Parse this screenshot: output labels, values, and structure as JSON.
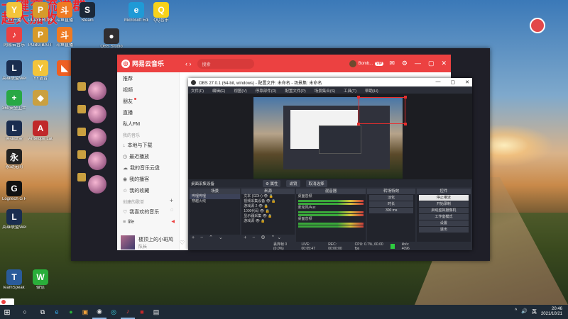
{
  "watermark": {
    "line1": "一键交流进群",
    "line2": "超大加收"
  },
  "desktop": {
    "icons": [
      {
        "label": "YY开播",
        "color": "#f3c43a",
        "glyph": "Y"
      },
      {
        "label": "PLAYERUNKNOWN'S BATTLEG...",
        "color": "#d79a2a",
        "glyph": "P"
      },
      {
        "label": "斗鱼直播",
        "color": "#ef7a22",
        "glyph": "斗"
      },
      {
        "label": "Steam",
        "color": "#1b2838",
        "glyph": "S"
      },
      {
        "label": "Microsoft Edge",
        "color": "#1f9ad6",
        "glyph": "e"
      },
      {
        "label": "QQ音乐",
        "color": "#f7d21b",
        "glyph": "Q"
      },
      {
        "label": "网易云音乐",
        "color": "#ec4141",
        "glyph": "♪"
      },
      {
        "label": "PUBG BATTLEGR...",
        "color": "#d79a2a",
        "glyph": "P"
      },
      {
        "label": "斗鱼直播",
        "color": "#ef7a22",
        "glyph": "斗"
      },
      {
        "label": "OBS Studio",
        "color": "#302e31",
        "glyph": "●"
      },
      {
        "label": "",
        "color": "#333",
        "glyph": "◉"
      },
      {
        "label": "",
        "color": "#f3c43a",
        "glyph": "★"
      },
      {
        "label": "",
        "color": "#c2302c",
        "glyph": "Q"
      },
      {
        "label": "英雄联盟WeGame版",
        "color": "#1a2d4f",
        "glyph": "L"
      },
      {
        "label": "YY语音",
        "color": "#f3c43a",
        "glyph": "Y"
      },
      {
        "label": "",
        "color": "#ef5f22",
        "glyph": "◣"
      },
      {
        "label": "360安全卫士",
        "color": "#28a845",
        "glyph": "+"
      },
      {
        "label": "",
        "color": "#caa040",
        "glyph": "◆"
      },
      {
        "label": "英雄联盟",
        "color": "#1a2d4f",
        "glyph": "L"
      },
      {
        "label": "Antelope Launcher",
        "color": "#c0282a",
        "glyph": "A"
      },
      {
        "label": "永劫无间",
        "color": "#222",
        "glyph": "永"
      },
      {
        "label": "Logitech G HUB",
        "color": "#111",
        "glyph": "G"
      },
      {
        "label": "英雄联盟WeGame版",
        "color": "#1a2d4f",
        "glyph": "L"
      },
      {
        "label": "TeamSpeak 3",
        "color": "#2a5b9a",
        "glyph": "T"
      },
      {
        "label": "微信",
        "color": "#2aae3a",
        "glyph": "W"
      },
      {
        "label": "",
        "color": "#ec4141",
        "glyph": "◎"
      }
    ]
  },
  "netease": {
    "title": "网易云音乐",
    "nav": "‹  ›",
    "search_placeholder": "搜索",
    "user": "Bomb...",
    "vip": "VIP",
    "controls": [
      "✉",
      "⚙",
      "—",
      "▢",
      "✕"
    ],
    "side_items": [
      {
        "label": "推荐",
        "icon": ""
      },
      {
        "label": "视频",
        "icon": ""
      },
      {
        "label": "朋友",
        "icon": "",
        "dot": true
      },
      {
        "label": "直播",
        "icon": ""
      },
      {
        "label": "私人FM",
        "icon": ""
      }
    ],
    "my_music_title": "我的音乐",
    "my_music": [
      {
        "label": "本地与下载",
        "icon": "↓"
      },
      {
        "label": "最近播放",
        "icon": "◷"
      },
      {
        "label": "我的音乐云盘",
        "icon": "☁"
      },
      {
        "label": "我的播客",
        "icon": "◉"
      },
      {
        "label": "我的收藏",
        "icon": "☆"
      }
    ],
    "created_title": "创建的歌单",
    "liked": {
      "label": "我喜欢的音乐",
      "icon": "♡"
    },
    "playlist": {
      "label": "life",
      "icon": "≡"
    },
    "song": {
      "title": "楼顶上的小斑鸠",
      "artist": "队长"
    },
    "progress": 0.35,
    "page_tabs": [
      "",
      "",
      ""
    ]
  },
  "obs": {
    "title": "OBS 27.0.1 (64-bit, windows) - 配置文件: 未命名 - 场景集: 未命名",
    "menu": [
      "文件(F)",
      "编辑(E)",
      "视图(V)",
      "停靠部件(D)",
      "配置文件(P)",
      "场景集合(S)",
      "工具(T)",
      "帮助(H)"
    ],
    "bar": {
      "source_label": "桌面采集设备",
      "props": "⚙ 属性",
      "filters": "滤镜",
      "action": "取消选择"
    },
    "panels": {
      "scenes": {
        "title": "场景",
        "rows": [
          "哔哩哔哩",
          "穿越火线"
        ]
      },
      "sources": {
        "title": "来源",
        "rows": [
          "文本 (GDI+)",
          "视频采集设备",
          "游戏源 2",
          "1000代码",
          "显示器采集",
          "游戏源"
        ]
      },
      "mixer": {
        "title": "混音器",
        "rows": [
          "桌面音频",
          "麦克风/Aux",
          "桌面音频"
        ]
      },
      "transitions": {
        "title": "转场特效",
        "rows": [
          "淡化",
          "时长",
          "300 ms"
        ]
      },
      "controls": {
        "title": "控件",
        "buttons": [
          "停止推流",
          "开始录制",
          "启动虚拟摄像机",
          "工作室模式",
          "设置",
          "退出"
        ]
      }
    },
    "status": {
      "dropped": "丢弃帧 0 (0.0%)",
      "live": "LIVE: 00:05:47",
      "rec": "REC: 00:00:00",
      "cpu": "CPU: 0.7%, 60.00 fps",
      "kbps": "kb/s: 4096"
    }
  },
  "taskbar": {
    "start": "⊞",
    "search": "○",
    "apps": [
      {
        "glyph": "⧉",
        "color": "#fff"
      },
      {
        "glyph": "e",
        "color": "#36a3e0"
      },
      {
        "glyph": "●",
        "color": "#2aae3a"
      },
      {
        "glyph": "▣",
        "color": "#f2a33a"
      },
      {
        "glyph": "◉",
        "color": "#ddd"
      },
      {
        "glyph": "◎",
        "color": "#3ad1e0"
      },
      {
        "glyph": "♪",
        "color": "#ec4141"
      },
      {
        "glyph": "■",
        "color": "#c0282a"
      },
      {
        "glyph": "▤",
        "color": "#eee"
      }
    ],
    "tray": [
      "^",
      "🔊",
      "英"
    ],
    "time": "20:46",
    "date": "2021/10/21"
  }
}
